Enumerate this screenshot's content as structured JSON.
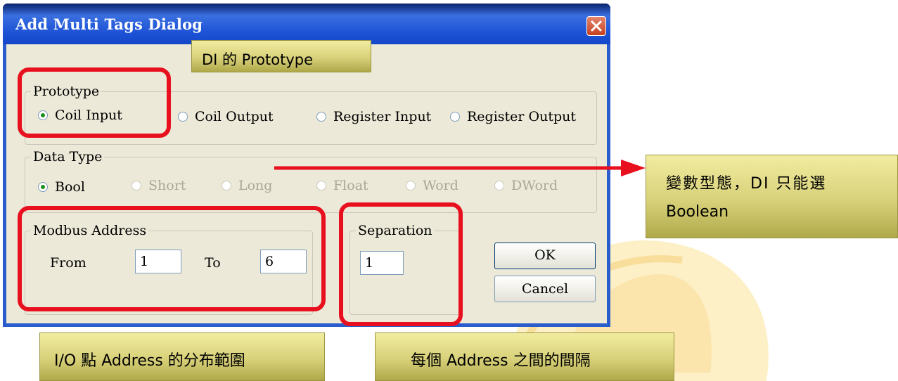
{
  "dialog": {
    "title": "Add Multi Tags Dialog",
    "close_icon": "close-icon",
    "prototype": {
      "label": "Prototype",
      "options": [
        "Coil Input",
        "Coil Output",
        "Register Input",
        "Register Output"
      ],
      "selected": "Coil Input"
    },
    "data_type": {
      "label": "Data Type",
      "options": [
        "Bool",
        "Short",
        "Long",
        "Float",
        "Word",
        "DWord"
      ],
      "selected": "Bool",
      "disabled": [
        "Short",
        "Long",
        "Float",
        "Word",
        "DWord"
      ]
    },
    "modbus_address": {
      "label": "Modbus Address",
      "from_label": "From",
      "from_value": "1",
      "to_label": "To",
      "to_value": "6"
    },
    "separation": {
      "label": "Separation",
      "value": "1"
    },
    "ok_label": "OK",
    "cancel_label": "Cancel"
  },
  "annotations": {
    "prototype_note": "DI 的 Prototype",
    "data_type_note_line1": "變數型態，DI 只能選",
    "data_type_note_line2": "Boolean",
    "address_note": "I/O 點  Address 的分布範圍",
    "separation_note": "每個 Address 之間的間隔"
  },
  "colors": {
    "annotation_red": "#e8101e",
    "callout_fill": "#d8d17a",
    "titlebar_blue": "#1e54d6",
    "dialog_face": "#ece9d8"
  }
}
